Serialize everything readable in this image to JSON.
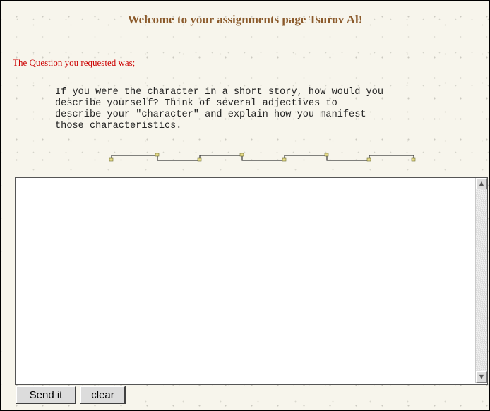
{
  "page": {
    "title": "Welcome to your assignments page Tsurov Al!",
    "intro": "The Question you requested was;",
    "question": "If you were the character in a short story, how would you\ndescribe yourself? Think of several adjectives to\ndescribe your \"character\" and explain how you manifest\nthose characteristics."
  },
  "answer": {
    "value": ""
  },
  "buttons": {
    "send": "Send it",
    "clear": "clear"
  },
  "icons": {
    "scroll_up": "scroll-up-arrow-icon",
    "scroll_down": "scroll-down-arrow-icon"
  },
  "colors": {
    "title": "#8b5a2b",
    "intro": "#cc0000",
    "background": "#f7f5ec"
  }
}
